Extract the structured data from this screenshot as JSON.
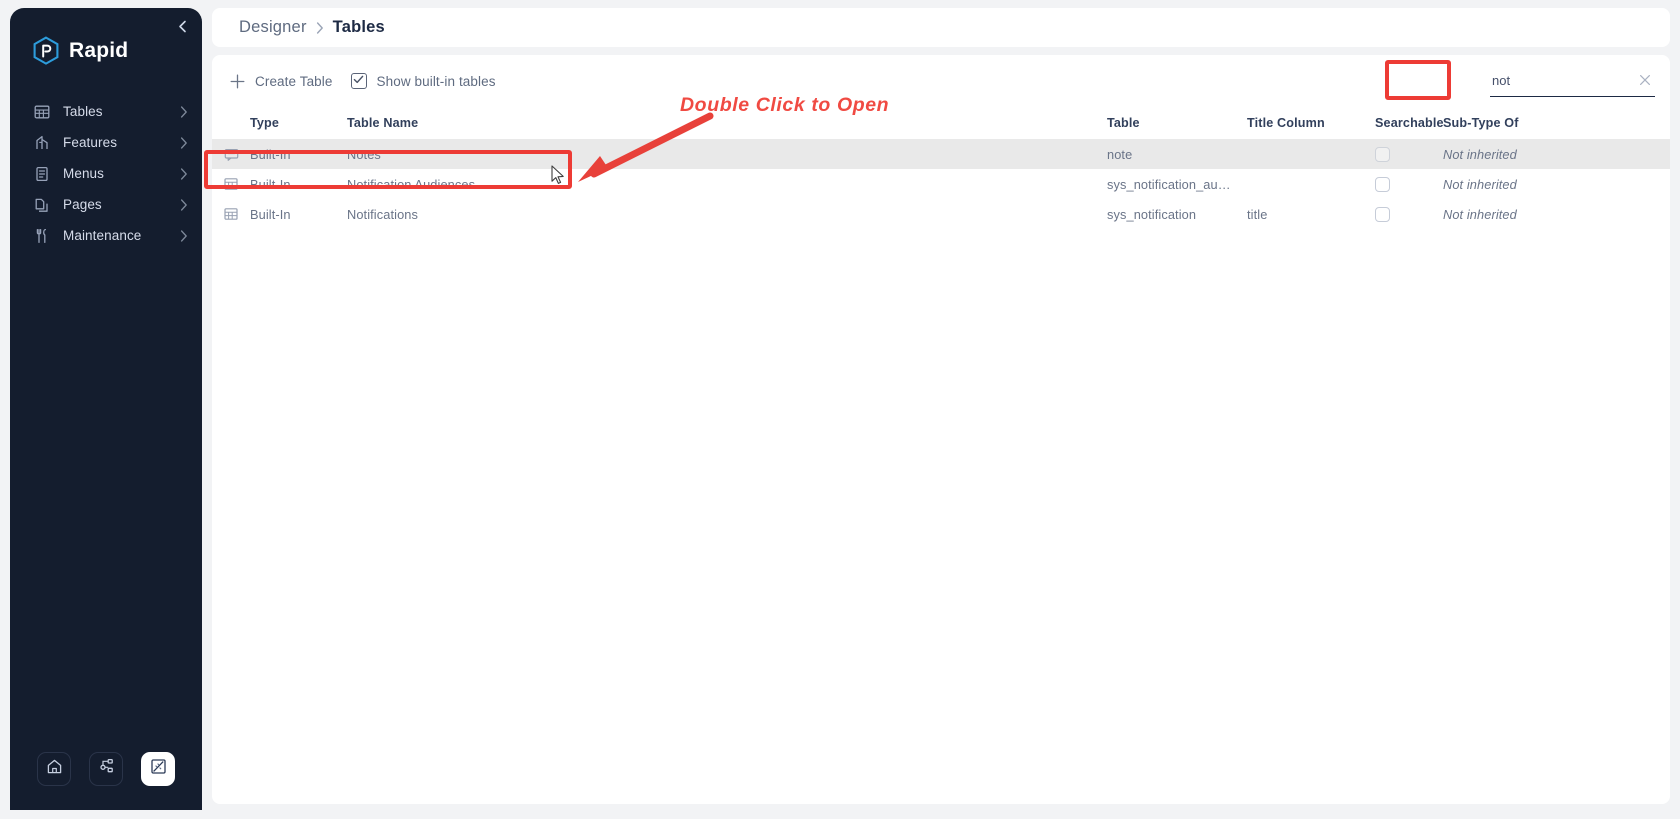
{
  "sidebar": {
    "brand_name": "Rapid",
    "brand_icon": "rapid-hex-logo",
    "collapse_icon": "chevron-left-icon",
    "items": [
      {
        "label": "Tables",
        "icon": "table-grid-icon",
        "chevron": "chevron-right-icon"
      },
      {
        "label": "Features",
        "icon": "crane-icon",
        "chevron": "chevron-right-icon"
      },
      {
        "label": "Menus",
        "icon": "list-document-icon",
        "chevron": "chevron-right-icon"
      },
      {
        "label": "Pages",
        "icon": "pages-copy-icon",
        "chevron": "chevron-right-icon"
      },
      {
        "label": "Maintenance",
        "icon": "tools-icon",
        "chevron": "chevron-right-icon"
      }
    ],
    "footer_buttons": [
      {
        "icon": "home-icon",
        "active": false
      },
      {
        "icon": "workflow-icon",
        "active": false
      },
      {
        "icon": "designer-ruler-pencil-icon",
        "active": true
      }
    ]
  },
  "breadcrumb": {
    "parent": "Designer",
    "separator": "chevron-right-icon",
    "current": "Tables"
  },
  "toolbar": {
    "create_table_label": "Create Table",
    "create_table_icon": "plus-icon",
    "show_builtin_label": "Show built-in tables",
    "show_builtin_checked": true,
    "checkbox_icon": "check-icon"
  },
  "search": {
    "value": "not",
    "placeholder": "",
    "clear_icon": "close-x-icon"
  },
  "table": {
    "columns": {
      "type": "Type",
      "table_name": "Table Name",
      "table": "Table",
      "title_column": "Title Column",
      "searchable": "Searchable",
      "sub_type_of": "Sub-Type Of"
    },
    "rows": [
      {
        "row_icon": "comment-bubble-icon",
        "type": "Built-In",
        "table_name": "Notes",
        "table": "note",
        "title_column": "",
        "searchable": false,
        "sub_type_of": "Not inherited",
        "selected": true
      },
      {
        "row_icon": "table-grid-icon",
        "type": "Built-In",
        "table_name": "Notification Audiences",
        "table": "sys_notification_au…",
        "title_column": "",
        "searchable": false,
        "sub_type_of": "Not inherited",
        "selected": false
      },
      {
        "row_icon": "table-grid-icon",
        "type": "Built-In",
        "table_name": "Notifications",
        "table": "sys_notification",
        "title_column": "title",
        "searchable": false,
        "sub_type_of": "Not inherited",
        "selected": false
      }
    ]
  },
  "annotations": {
    "callout_text": "Double Click to Open",
    "highlight_color": "#ed3b35",
    "arrow_icon": "arrow-pointing-down-left-icon",
    "cursor_icon": "mouse-pointer-icon"
  }
}
